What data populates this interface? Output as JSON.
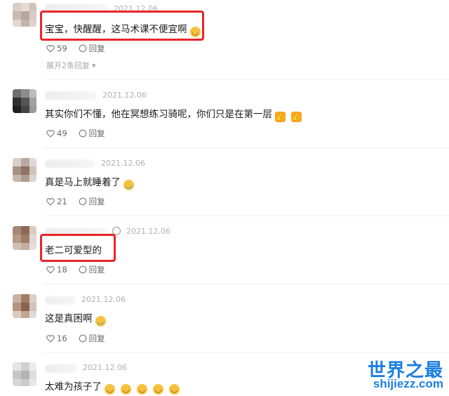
{
  "comments": [
    {
      "date": "2021.12.06",
      "text": "宝宝，快醒醒，这马术课不便宜啊",
      "likes": "59",
      "reply_label": "回复",
      "emoji": [
        "grin"
      ]
    },
    {
      "date": "2021.12.06",
      "text": "其实你们不懂，他在冥想练习骑呢，你们只是在第一层",
      "likes": "49",
      "reply_label": "回复",
      "emoji": [
        "thumbs-up",
        "thumbs-up"
      ]
    },
    {
      "date": "2021.12.06",
      "text": "真是马上就睡着了",
      "likes": "21",
      "reply_label": "回复",
      "emoji": [
        "laugh-cry"
      ]
    },
    {
      "date": "2021.12.06",
      "text": "老二可爱型的",
      "likes": "18",
      "reply_label": "回复",
      "emoji": []
    },
    {
      "date": "2021.12.06",
      "text": "这是真困啊",
      "likes": "16",
      "reply_label": "回复",
      "emoji": [
        "laugh-cry"
      ]
    },
    {
      "date": "2021.12.06",
      "text": "太难为孩子了",
      "emoji": [
        "laugh",
        "laugh",
        "laugh",
        "laugh",
        "laugh"
      ]
    }
  ],
  "expand_replies": "展开2条回复",
  "watermark": {
    "title": "世界之最",
    "url": "shijiezz.com"
  },
  "colors": {
    "highlight": "#e8262a",
    "watermark": "#1c7fe0"
  }
}
